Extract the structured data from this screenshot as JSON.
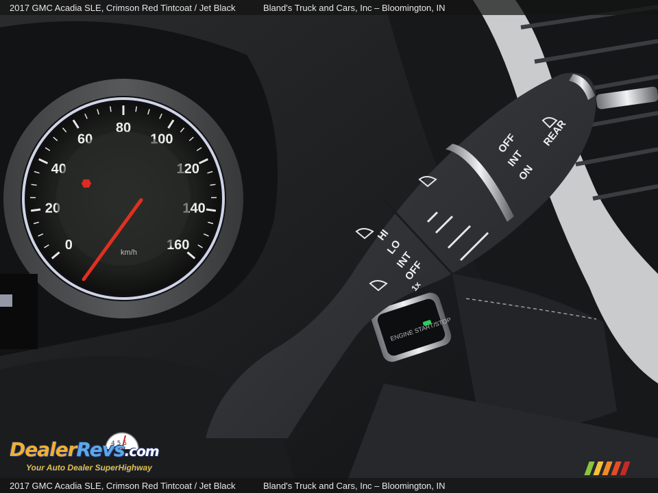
{
  "caption": {
    "vehicle": "2017 GMC Acadia SLE,   Crimson Red Tintcoat / Jet Black",
    "dealer": "Bland's Truck and Cars, Inc – Bloomington, IN"
  },
  "speedometer": {
    "ticks": [
      "0",
      "20",
      "40",
      "60",
      "80",
      "100",
      "120",
      "140",
      "160"
    ],
    "unit": "km/h"
  },
  "wiper_stalk": {
    "labels": [
      "HI",
      "LO",
      "INT",
      "OFF",
      "1x",
      "OFF",
      "INT",
      "ON",
      "REAR"
    ]
  },
  "start_button": {
    "label": "ENGINE START/STOP"
  },
  "watermark": {
    "logo_part1": "Dealer",
    "logo_part2": "Revs",
    "logo_suffix": ".com",
    "tagline": "Your Auto Dealer SuperHighway",
    "gauge_digits": "4 5 6"
  },
  "colors": {
    "needle": "#e03020",
    "stalk": "#2c2e31",
    "stripe_colors": [
      "#8ac440",
      "#f2c23a",
      "#f08a2a",
      "#e64b2a",
      "#c42a26"
    ]
  }
}
